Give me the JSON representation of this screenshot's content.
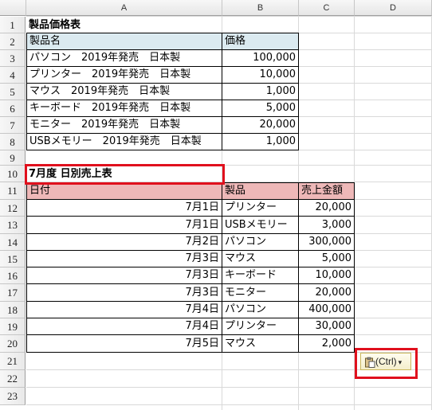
{
  "columns": [
    "A",
    "B",
    "C",
    "D"
  ],
  "rows": [
    "1",
    "2",
    "3",
    "4",
    "5",
    "6",
    "7",
    "8",
    "9",
    "10",
    "11",
    "12",
    "13",
    "14",
    "15",
    "16",
    "17",
    "18",
    "19",
    "20",
    "21",
    "22",
    "23"
  ],
  "price_table": {
    "title": "製品価格表",
    "header": {
      "name": "製品名",
      "price": "価格"
    },
    "items": [
      {
        "name": "パソコン　2019年発売　日本製",
        "price": "100,000"
      },
      {
        "name": "プリンター　2019年発売　日本製",
        "price": "10,000"
      },
      {
        "name": "マウス　2019年発売　日本製",
        "price": "1,000"
      },
      {
        "name": "キーボード　2019年発売　日本製",
        "price": "5,000"
      },
      {
        "name": "モニター　2019年発売　日本製",
        "price": "20,000"
      },
      {
        "name": "USBメモリー　2019年発売　日本製",
        "price": "1,000"
      }
    ]
  },
  "sales_table": {
    "title": "7月度 日別売上表",
    "header": {
      "date": "日付",
      "product": "製品",
      "amount": "売上金額"
    },
    "items": [
      {
        "date": "7月1日",
        "product": "プリンター",
        "amount": "20,000"
      },
      {
        "date": "7月1日",
        "product": "USBメモリー",
        "amount": "3,000"
      },
      {
        "date": "7月2日",
        "product": "パソコン",
        "amount": "300,000"
      },
      {
        "date": "7月3日",
        "product": "マウス",
        "amount": "5,000"
      },
      {
        "date": "7月3日",
        "product": "キーボード",
        "amount": "10,000"
      },
      {
        "date": "7月3日",
        "product": "モニター",
        "amount": "20,000"
      },
      {
        "date": "7月4日",
        "product": "パソコン",
        "amount": "400,000"
      },
      {
        "date": "7月4日",
        "product": "プリンター",
        "amount": "30,000"
      },
      {
        "date": "7月5日",
        "product": "マウス",
        "amount": "2,000"
      }
    ]
  },
  "paste_options": {
    "label": "(Ctrl)",
    "icon": "clipboard-icon",
    "arrow": "▾"
  },
  "colors": {
    "highlight": "#e0101d",
    "header_blue": "#dbeaf0",
    "header_pink": "#eeb8b8"
  }
}
